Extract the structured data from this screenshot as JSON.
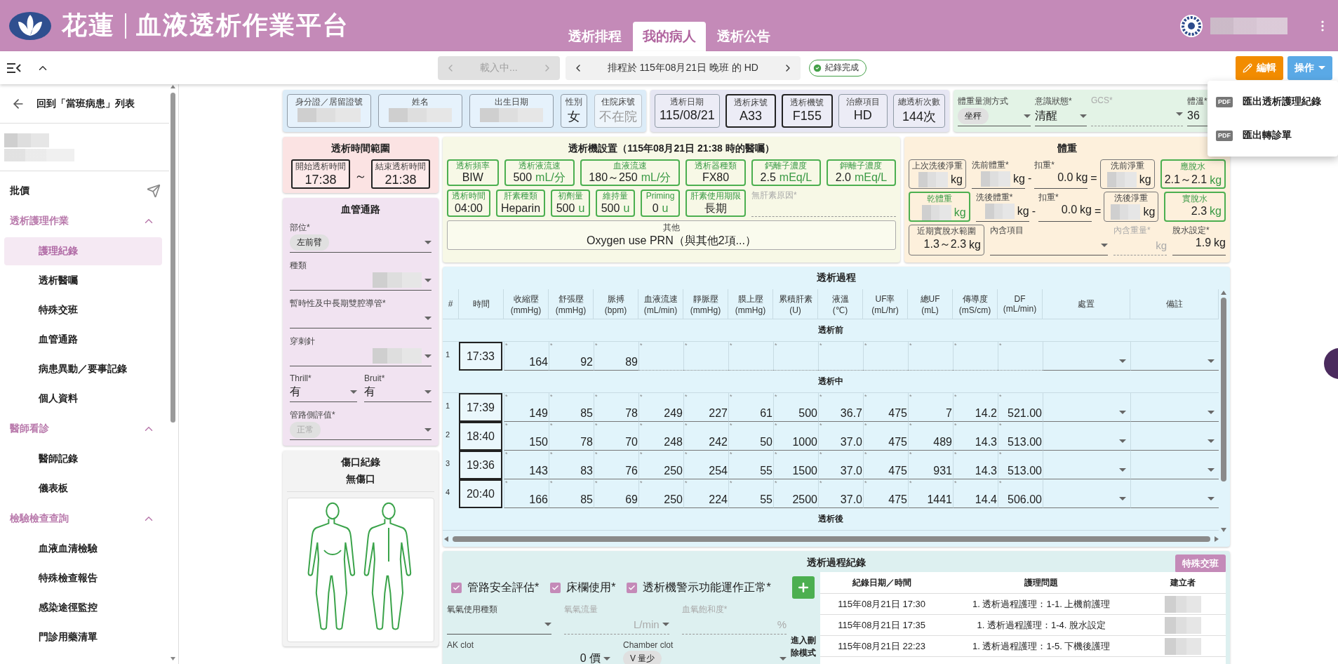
{
  "header": {
    "brand_place": "花蓮",
    "brand_title": "血液透析作業平台",
    "tabs": [
      {
        "label": "透析排程",
        "selected": false
      },
      {
        "label": "我的病人",
        "selected": true
      },
      {
        "label": "透析公告",
        "selected": false
      }
    ]
  },
  "toolbar": {
    "prev_patient": "載入中...",
    "schedule": "排程於 115年08月21日 晚班 的 HD",
    "status": "紀錄完成",
    "edit": "編輯",
    "actions": "操作"
  },
  "action_menu": [
    {
      "badge": "PDF",
      "label": "匯出透析護理紀錄"
    },
    {
      "badge": "PDF",
      "label": "匯出轉診單"
    }
  ],
  "sidebar": {
    "back": "回到「當班病患」列表",
    "items": [
      {
        "kind": "action",
        "label": "批價"
      },
      {
        "kind": "group",
        "label": "透析護理作業",
        "expanded": true,
        "children": [
          {
            "label": "護理紀錄",
            "selected": true
          },
          {
            "label": "透析醫囑",
            "selected": false
          },
          {
            "label": "特殊交班",
            "selected": false
          },
          {
            "label": "血管通路",
            "selected": false
          },
          {
            "label": "病患異動／要事記錄",
            "selected": false
          },
          {
            "label": "個人資料",
            "selected": false
          }
        ]
      },
      {
        "kind": "group",
        "label": "醫師看診",
        "expanded": true,
        "children": [
          {
            "label": "醫師記錄",
            "selected": false
          },
          {
            "label": "儀表板",
            "selected": false
          }
        ]
      },
      {
        "kind": "group",
        "label": "檢驗檢查查詢",
        "expanded": true,
        "children": [
          {
            "label": "血液血清檢驗",
            "selected": false
          },
          {
            "label": "特殊檢查報告",
            "selected": false
          },
          {
            "label": "感染途徑監控",
            "selected": false
          },
          {
            "label": "門診用藥清單",
            "selected": false
          }
        ]
      }
    ]
  },
  "patient": {
    "fields": [
      {
        "label": "身分證／居留證號",
        "kind": "redacted",
        "disabled": false
      },
      {
        "label": "姓名",
        "kind": "redacted",
        "disabled": false
      },
      {
        "label": "出生日期",
        "kind": "redacted",
        "disabled": false
      },
      {
        "label": "性別",
        "kind": "text",
        "value": "女",
        "disabled": false
      },
      {
        "label": "住院床號",
        "kind": "text",
        "value": "不在院",
        "disabled": true
      }
    ]
  },
  "session": {
    "fields": [
      {
        "label": "透析日期",
        "value": "115/08/21",
        "highlighted": false
      },
      {
        "label": "透析床號",
        "value": "A33",
        "highlighted": true
      },
      {
        "label": "透析機號",
        "value": "F155",
        "highlighted": true
      },
      {
        "label": "治療項目",
        "value": "HD",
        "highlighted": false
      },
      {
        "label": "總透析次數",
        "value": "144次",
        "highlighted": false
      }
    ]
  },
  "vitals": {
    "fields": [
      {
        "label": "體重量測方式",
        "kind": "chip",
        "value": "坐秤"
      },
      {
        "label": "意識狀態*",
        "kind": "text",
        "value": "清醒"
      },
      {
        "label": "GCS*",
        "kind": "disabled"
      },
      {
        "label": "體溫*",
        "kind": "plain",
        "value": "36"
      }
    ]
  },
  "time_range": {
    "title": "透析時間範圍",
    "start": {
      "label": "開始透析時間",
      "value": "17:38"
    },
    "separator": "～",
    "end": {
      "label": "結束透析時間",
      "value": "21:38"
    }
  },
  "access": {
    "title": "血管通路",
    "lines": [
      {
        "fields": [
          {
            "label": "部位*",
            "kind": "chip",
            "value": "左前臂"
          }
        ]
      },
      {
        "fields": [
          {
            "label": "種類",
            "kind": "redacted"
          }
        ]
      },
      {
        "fields": [
          {
            "label": "暫時性及中長期雙腔導管*",
            "kind": "empty"
          }
        ]
      },
      {
        "fields": [
          {
            "label": "穿刺針",
            "kind": "redacted"
          }
        ]
      },
      {
        "fields": [
          {
            "label": "Thrill*",
            "kind": "text",
            "value": "有"
          },
          {
            "label": "Bruit*",
            "kind": "text",
            "value": "有"
          }
        ]
      },
      {
        "fields": [
          {
            "label": "管路側評值*",
            "kind": "faint_chip",
            "value": "正常"
          }
        ]
      }
    ]
  },
  "wound": {
    "title": "傷口紀錄",
    "status": "無傷口"
  },
  "machine": {
    "title": "透析機設置（115年08月21日 21:38 時的醫囑）",
    "lines": [
      {
        "boxes": [
          {
            "label": "透析頻率",
            "value": "BIW"
          },
          {
            "label": "透析液流速",
            "value": "500",
            "unit": "mL/分"
          },
          {
            "label": "血液流速",
            "value": "180～250",
            "unit": "mL/分"
          },
          {
            "label": "透析器種類",
            "value": "FX80"
          },
          {
            "label": "鈣離子濃度",
            "value": "2.5",
            "unit": "mEq/L"
          },
          {
            "label": "鉀離子濃度",
            "value": "2.0",
            "unit": "mEq/L"
          }
        ]
      },
      {
        "boxes": [
          {
            "label": "透析時間",
            "value": "04:00"
          },
          {
            "label": "肝素種類",
            "value": "Heparin"
          },
          {
            "label": "初劑量",
            "value": "500",
            "unit": "u"
          },
          {
            "label": "維持量",
            "value": "500",
            "unit": "u"
          },
          {
            "label": "Priming",
            "value": "0",
            "unit": "u"
          },
          {
            "label": "肝素使用期限",
            "value": "長期"
          }
        ],
        "note": "無肝素原因*"
      }
    ],
    "other": {
      "label": "其他",
      "value": "Oxygen use PRN（與其他2項...）"
    }
  },
  "weight": {
    "title": "體重",
    "lines": [
      {
        "cells": [
          {
            "kind": "box",
            "label": "上次洗後淨重",
            "redacted": true,
            "unit": "kg"
          },
          {
            "kind": "field",
            "label": "洗前體重*",
            "redacted": true,
            "unit": "kg"
          },
          {
            "kind": "op",
            "text": "-"
          },
          {
            "kind": "field",
            "label": "扣重*",
            "value": "0.0",
            "redacted": false,
            "unit": "kg"
          },
          {
            "kind": "op",
            "text": "="
          },
          {
            "kind": "box",
            "label": "洗前淨重",
            "redacted": true,
            "unit": "kg"
          },
          {
            "kind": "green",
            "label": "應脫水",
            "value": "2.1～2.1",
            "redacted": false,
            "unit": "kg"
          }
        ]
      },
      {
        "cells": [
          {
            "kind": "green",
            "label": "乾體重",
            "redacted": true,
            "unit": "kg"
          },
          {
            "kind": "field",
            "label": "洗後體重*",
            "redacted": true,
            "unit": "kg"
          },
          {
            "kind": "op",
            "text": "-"
          },
          {
            "kind": "field",
            "label": "扣重*",
            "value": "0.0",
            "redacted": false,
            "unit": "kg"
          },
          {
            "kind": "op",
            "text": "="
          },
          {
            "kind": "box",
            "label": "洗後淨重",
            "redacted": true,
            "unit": "kg"
          },
          {
            "kind": "green",
            "label": "實脫水",
            "value": "2.3",
            "redacted": false,
            "unit": "kg"
          }
        ]
      },
      {
        "cells": [
          {
            "kind": "box",
            "label": "近期實脫水範圍",
            "value": "1.3～2.3",
            "redacted": false,
            "unit": "kg"
          },
          {
            "kind": "select",
            "label": "內含項目"
          },
          {
            "kind": "disabled",
            "label": "內含重量*",
            "unit": "kg"
          },
          {
            "kind": "field",
            "label": "脫水設定*",
            "value": "1.9",
            "redacted": false,
            "unit": "kg"
          }
        ]
      }
    ]
  },
  "process": {
    "title": "透析過程",
    "columns": [
      {
        "label": "#"
      },
      {
        "label": "時間"
      },
      {
        "label": "收縮壓",
        "unit": "(mmHg)"
      },
      {
        "label": "舒張壓",
        "unit": "(mmHg)"
      },
      {
        "label": "脈搏",
        "unit": "(bpm)"
      },
      {
        "label": "血液流速",
        "unit": "(mL/min)"
      },
      {
        "label": "靜脈壓",
        "unit": "(mmHg)"
      },
      {
        "label": "膜上壓",
        "unit": "(mmHg)"
      },
      {
        "label": "累積肝素",
        "unit": "(U)"
      },
      {
        "label": "液溫",
        "unit": "(℃)"
      },
      {
        "label": "UF率",
        "unit": "(mL/hr)"
      },
      {
        "label": "總UF",
        "unit": "(mL)"
      },
      {
        "label": "傳導度",
        "unit": "(mS/cm)"
      },
      {
        "label": "DF",
        "unit": "(mL/min)"
      },
      {
        "label": "處置"
      },
      {
        "label": "備註"
      }
    ],
    "sections": [
      {
        "title": "透析前",
        "rows": [
          {
            "no": "1",
            "time": "17:33",
            "mark": "*",
            "values": [
              "164",
              "92",
              "89"
            ]
          }
        ]
      },
      {
        "title": "透析中",
        "rows": [
          {
            "no": "1",
            "time": "17:39",
            "mark": "*",
            "values": [
              "149",
              "85",
              "78",
              "249",
              "227",
              "61",
              "500",
              "36.7",
              "475",
              "7",
              "14.2",
              "521.00"
            ]
          },
          {
            "no": "2",
            "time": "18:40",
            "mark": "*",
            "values": [
              "150",
              "78",
              "70",
              "248",
              "242",
              "50",
              "1000",
              "37.0",
              "475",
              "489",
              "14.3",
              "513.00"
            ]
          },
          {
            "no": "3",
            "time": "19:36",
            "mark": "*",
            "values": [
              "143",
              "83",
              "76",
              "250",
              "254",
              "55",
              "1500",
              "37.0",
              "475",
              "931",
              "14.3",
              "513.00"
            ]
          },
          {
            "no": "4",
            "time": "20:40",
            "mark": "*",
            "values": [
              "166",
              "85",
              "69",
              "250",
              "224",
              "55",
              "2500",
              "37.0",
              "475",
              "1441",
              "14.4",
              "506.00"
            ]
          }
        ]
      },
      {
        "title": "透析後"
      }
    ]
  },
  "record": {
    "title": "透析過程紀錄",
    "handoff_button": "特殊交班",
    "checks": [
      {
        "label": "管路安全評估*",
        "checked": true
      },
      {
        "label": "床欄使用*",
        "checked": true
      },
      {
        "label": "透析機警示功能運作正常*",
        "checked": true
      }
    ],
    "lines": [
      {
        "fields": [
          {
            "label": "氧氣使用種類",
            "kind": "select"
          },
          {
            "label": "氧氣流量",
            "kind": "disabled_select",
            "unit": "L/min"
          },
          {
            "label": "血氧飽和度*",
            "kind": "disabled",
            "unit": "%"
          }
        ]
      },
      {
        "fields": [
          {
            "label": "AK clot",
            "kind": "select",
            "value": "0 價"
          },
          {
            "label": "Chamber clot",
            "kind": "chip",
            "value": "V 量少"
          }
        ]
      }
    ],
    "delete_mode": "進入刪除模式",
    "log_columns": [
      "紀錄日期／時間",
      "護理問題",
      "建立者"
    ],
    "log_rows": [
      {
        "time": "115年08月21日 17:30",
        "problem": "1. 透析過程護理：1-1. 上機前護理"
      },
      {
        "time": "115年08月21日 17:35",
        "problem": "1. 透析過程護理：1-4. 脫水設定"
      },
      {
        "time": "115年08月21日 22:23",
        "problem": "1. 透析過程護理：1-5. 下機後護理"
      }
    ]
  }
}
